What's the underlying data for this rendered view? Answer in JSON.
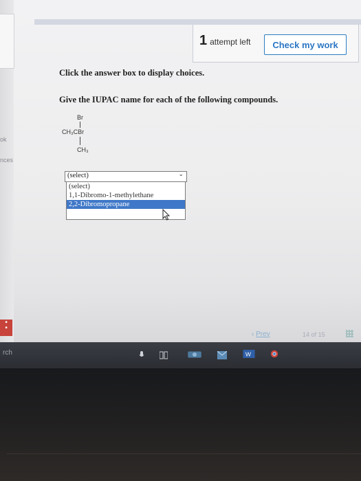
{
  "header": {
    "attempts_number": "1",
    "attempts_label": "attempt left",
    "check_button": "Check my work"
  },
  "instructions": {
    "line1": "Click the answer box to display choices.",
    "line2": "Give the IUPAC name for each of the following compounds."
  },
  "structure": {
    "top": "Br",
    "middle": "CH₃CBr",
    "bottom": "CH₃"
  },
  "select": {
    "current": "(select)",
    "options": [
      "(select)",
      "1,1-Dibromo-1-methylethane",
      "2,2-Dibromopropane"
    ],
    "highlighted_index": 2
  },
  "sidebar": {
    "frag1": "ok",
    "frag2": "nces"
  },
  "pager": {
    "prev": "Prev",
    "current": "14",
    "of": "of",
    "total": "15"
  },
  "taskbar": {
    "search_fragment": "rch"
  },
  "icons": [
    "arrow-down-icon",
    "cursor-icon",
    "grid-icon",
    "mic-icon",
    "task-view-icon",
    "camera-icon",
    "mail-icon",
    "word-icon",
    "chrome-icon"
  ],
  "colors": {
    "accent": "#2a76c3",
    "highlight": "#3f78c8"
  }
}
